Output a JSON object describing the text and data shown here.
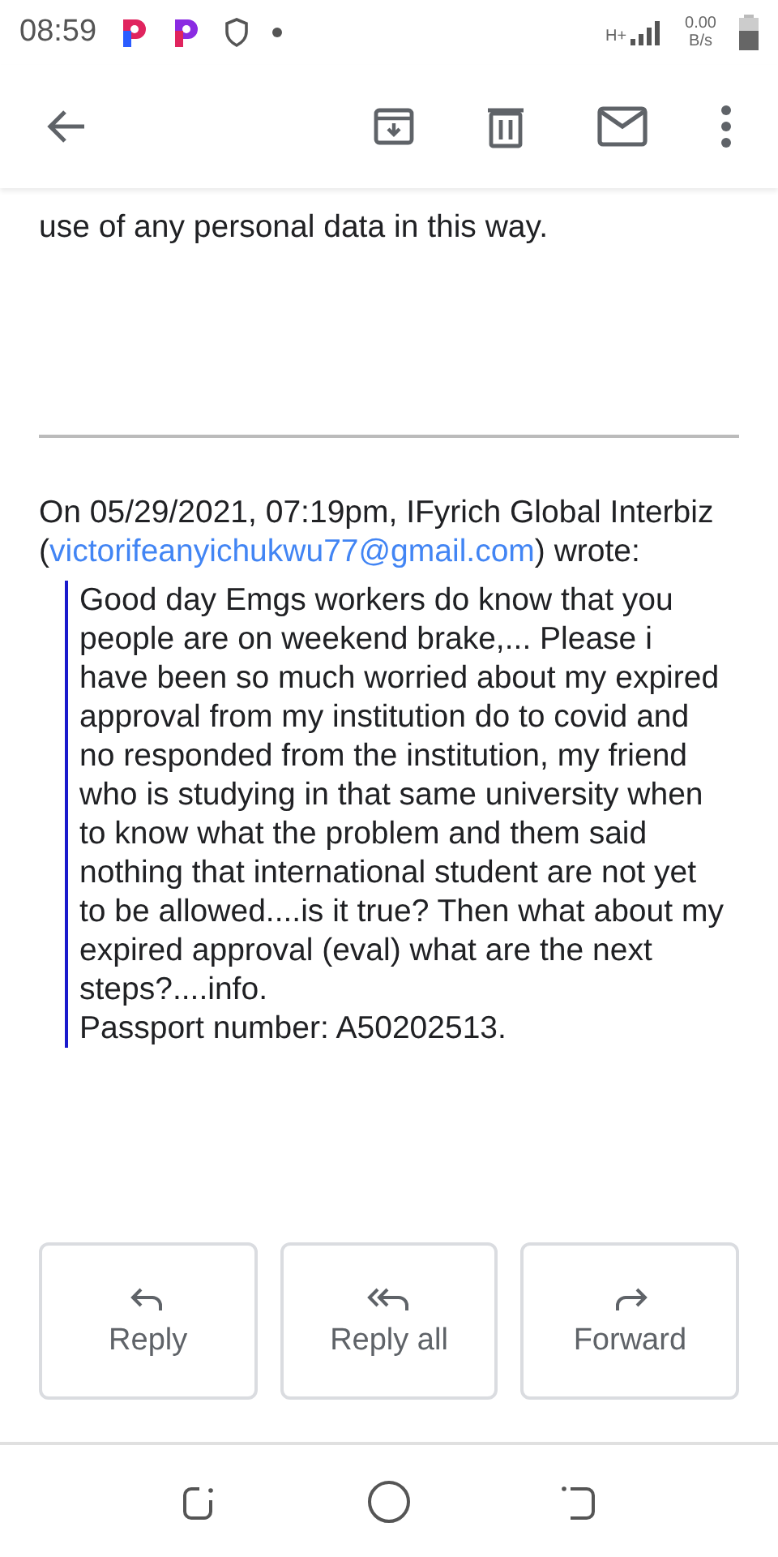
{
  "status_bar": {
    "time": "08:59",
    "network": "H+",
    "speed_value": "0.00",
    "speed_unit": "B/s"
  },
  "toolbar": {
    "actions": [
      {
        "kind": "archive"
      },
      {
        "kind": "delete"
      },
      {
        "kind": "mark-unread"
      },
      {
        "kind": "more"
      }
    ]
  },
  "email": {
    "notice": "use of any personal data in this way.",
    "quote_header": {
      "before": "On 05/29/2021, 07:19pm, IFyrich Global Interbiz (",
      "email": "victorifeanyichukwu77@gmail.com",
      "after": ") wrote:"
    },
    "quoted_paragraphs": [
      "Good day Emgs workers do know that you people are on weekend brake,... Please i have been so much worried about my expired approval from my institution do to covid and no responded from the institution, my friend who is studying in that same university when to know what the problem and them said nothing that international student are not yet to be allowed....is it true? Then what about my expired approval (eval) what are the next steps?....info.",
      "Passport number: A50202513."
    ]
  },
  "actions": [
    {
      "kind": "reply",
      "label": "Reply"
    },
    {
      "kind": "reply_all",
      "label": "Reply all"
    },
    {
      "kind": "forward",
      "label": "Forward"
    }
  ]
}
